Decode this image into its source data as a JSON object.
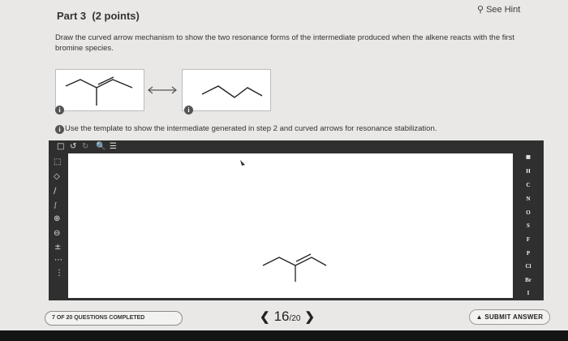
{
  "header": {
    "part_title": "Part 3",
    "points": "(2 points)",
    "hint_label": "See Hint"
  },
  "question": {
    "instructions": "Draw the curved arrow mechanism to show the two resonance forms of the intermediate produced when the alkene reacts with the first bromine species.",
    "template_hint": "Use the template to show the intermediate generated in step 2 and curved arrows for resonance stabilization."
  },
  "editor": {
    "toolbar_icons": [
      "new-icon",
      "undo-icon",
      "redo-icon",
      "zoom-icon",
      "settings-icon"
    ],
    "left_tools": [
      "select-icon",
      "eraser-icon",
      "bond-icon",
      "chain-icon",
      "plus-charge-icon",
      "minus-charge-icon",
      "radical-icon",
      "lone-pair-icon",
      "arrow-icon"
    ],
    "elements": [
      "H",
      "C",
      "N",
      "O",
      "S",
      "F",
      "P",
      "Cl",
      "Br",
      "I"
    ]
  },
  "footer": {
    "progress": "7 OF 20 QUESTIONS COMPLETED",
    "current_page": "16",
    "total_pages": "/20",
    "submit_label": "SUBMIT ANSWER"
  }
}
